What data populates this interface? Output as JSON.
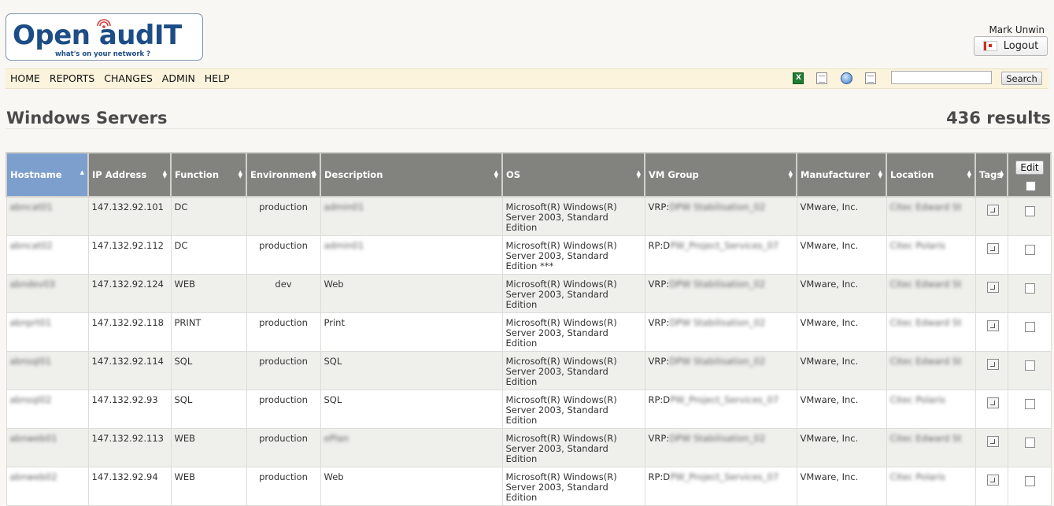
{
  "logo": {
    "name": "Open-AudIT",
    "text": "Open audIT",
    "tagline": "what's on your network ?"
  },
  "user": {
    "name": "Mark Unwin",
    "logout_label": "Logout",
    "flag_icon": "canada-flag-icon"
  },
  "nav": {
    "items": [
      "HOME",
      "REPORTS",
      "CHANGES",
      "ADMIN",
      "HELP"
    ]
  },
  "toolbar": {
    "icons": [
      "excel-export-icon",
      "csv-export-icon",
      "web-icon",
      "print-icon"
    ],
    "search_value": "",
    "search_label": "Search"
  },
  "page": {
    "title": "Windows Servers",
    "results": "436 results"
  },
  "table": {
    "columns": [
      "Hostname",
      "IP Address",
      "Function",
      "Environment",
      "Description",
      "OS",
      "VM Group",
      "Manufacturer",
      "Location",
      "Tags"
    ],
    "sorted_column": "Hostname",
    "sort_direction": "ascending",
    "edit_label": "Edit",
    "rows": [
      {
        "hostname": "abncat01",
        "ip": "147.132.92.101",
        "function": "DC",
        "environment": "production",
        "description": "admin01",
        "os": "Microsoft(R) Windows(R) Server 2003, Standard Edition",
        "vm_group": "VRP:DPW Stabilisation_02",
        "manufacturer": "VMware, Inc.",
        "location": "Citec Edward St"
      },
      {
        "hostname": "abncat02",
        "ip": "147.132.92.112",
        "function": "DC",
        "environment": "production",
        "description": "admin01",
        "os": "Microsoft(R) Windows(R) Server 2003, Standard Edition    ***",
        "vm_group": "RP:DPW_Project_Services_07",
        "manufacturer": "VMware, Inc.",
        "location": "Citec Polaris"
      },
      {
        "hostname": "abndev03",
        "ip": "147.132.92.124",
        "function": "WEB",
        "environment": "dev",
        "description": "Web",
        "os": "Microsoft(R) Windows(R) Server 2003, Standard Edition",
        "vm_group": "VRP:DPW Stabilisation_02",
        "manufacturer": "VMware, Inc.",
        "location": "Citec Edward St"
      },
      {
        "hostname": "abnprt01",
        "ip": "147.132.92.118",
        "function": "PRINT",
        "environment": "production",
        "description": "Print",
        "os": "Microsoft(R) Windows(R) Server 2003, Standard Edition",
        "vm_group": "VRP:DPW Stabilisation_02",
        "manufacturer": "VMware, Inc.",
        "location": "Citec Edward St"
      },
      {
        "hostname": "abnsql01",
        "ip": "147.132.92.114",
        "function": "SQL",
        "environment": "production",
        "description": "SQL",
        "os": "Microsoft(R) Windows(R) Server 2003, Standard Edition",
        "vm_group": "VRP:DPW Stabilisation_02",
        "manufacturer": "VMware, Inc.",
        "location": "Citec Edward St"
      },
      {
        "hostname": "abnsql02",
        "ip": "147.132.92.93",
        "function": "SQL",
        "environment": "production",
        "description": "SQL",
        "os": "Microsoft(R) Windows(R) Server 2003, Standard Edition",
        "vm_group": "RP:DPW_Project_Services_07",
        "manufacturer": "VMware, Inc.",
        "location": "Citec Polaris"
      },
      {
        "hostname": "abnweb01",
        "ip": "147.132.92.113",
        "function": "WEB",
        "environment": "production",
        "description": "ePlan",
        "os": "Microsoft(R) Windows(R) Server 2003, Standard Edition",
        "vm_group": "VRP:DPW Stabilisation_02",
        "manufacturer": "VMware, Inc.",
        "location": "Citec Edward St"
      },
      {
        "hostname": "abnweb02",
        "ip": "147.132.92.94",
        "function": "WEB",
        "environment": "production",
        "description": "Web",
        "os": "Microsoft(R) Windows(R) Server 2003, Standard Edition",
        "vm_group": "RP:DPW_Project_Services_07",
        "manufacturer": "VMware, Inc.",
        "location": "Citec Polaris"
      }
    ]
  }
}
